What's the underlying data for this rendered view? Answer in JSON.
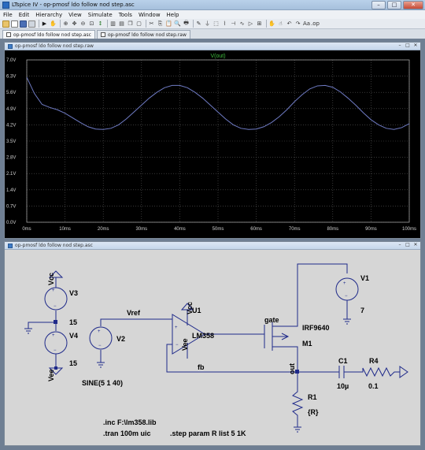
{
  "window": {
    "title": "LTspice IV - op-pmosf ldo follow nod step.asc",
    "minimize_label": "–",
    "maximize_label": "□",
    "close_label": "✕"
  },
  "menu": [
    "File",
    "Edit",
    "Hierarchy",
    "View",
    "Simulate",
    "Tools",
    "Window",
    "Help"
  ],
  "tabs": [
    {
      "label": "op-pmosf ldo follow nod step.asc",
      "active": true
    },
    {
      "label": "op-pmosf ldo follow nod step.raw",
      "active": false
    }
  ],
  "waveform_window": {
    "title": "op-pmosf ldo follow nod step.raw"
  },
  "schematic_window": {
    "title": "op-pmosf ldo follow nod step.asc"
  },
  "chart_data": {
    "type": "line",
    "title": "V(out)",
    "xlabel": "",
    "ylabel": "",
    "x_ticks": [
      "0ms",
      "10ms",
      "20ms",
      "30ms",
      "40ms",
      "50ms",
      "60ms",
      "70ms",
      "80ms",
      "90ms",
      "100ms"
    ],
    "y_ticks": [
      "7.0V",
      "6.3V",
      "5.6V",
      "4.9V",
      "4.2V",
      "3.5V",
      "2.8V",
      "2.1V",
      "1.4V",
      "0.7V",
      "0.0V"
    ],
    "xlim": [
      0,
      100
    ],
    "ylim": [
      0,
      7
    ],
    "grid": true,
    "series": [
      {
        "name": "V(out)",
        "color": "#6f7bc4",
        "x": [
          0,
          2,
          4,
          6,
          8,
          10,
          12,
          14,
          16,
          18,
          20,
          22,
          24,
          26,
          28,
          30,
          32,
          34,
          36,
          38,
          40,
          42,
          44,
          46,
          48,
          50,
          52,
          54,
          56,
          58,
          60,
          62,
          64,
          66,
          68,
          70,
          72,
          74,
          76,
          78,
          80,
          82,
          84,
          86,
          88,
          90,
          92,
          94,
          96,
          98,
          100
        ],
        "values": [
          6.25,
          5.55,
          5.08,
          4.95,
          4.85,
          4.7,
          4.5,
          4.3,
          4.12,
          4.02,
          4.0,
          4.05,
          4.2,
          4.45,
          4.75,
          5.05,
          5.35,
          5.6,
          5.8,
          5.9,
          5.9,
          5.8,
          5.6,
          5.35,
          5.05,
          4.75,
          4.45,
          4.2,
          4.05,
          4.0,
          4.02,
          4.12,
          4.3,
          4.55,
          4.85,
          5.2,
          5.5,
          5.75,
          5.88,
          5.9,
          5.82,
          5.62,
          5.35,
          5.05,
          4.72,
          4.42,
          4.2,
          4.05,
          4.0,
          4.08,
          4.25
        ]
      }
    ]
  },
  "schematic": {
    "labels": {
      "v3": "V3",
      "v3_val": "15",
      "vcc_net": "Vcc",
      "v4": "V4",
      "v4_val": "15",
      "vee_net": "Vee",
      "v2": "V2",
      "v2_val": "SINE(5 1 40)",
      "vref": "Vref",
      "u1": "U1",
      "u1_model": "LM358",
      "u1_vcc": "Vcc",
      "u1_vee": "Vee",
      "gate": "gate",
      "fb": "fb",
      "out": "out",
      "m1": "M1",
      "m1_model": "IRF9640",
      "v1": "V1",
      "v1_val": "7",
      "c1": "C1",
      "c1_val": "10µ",
      "r4": "R4",
      "r4_val": "0.1",
      "r1": "R1",
      "r1_val": "{R}",
      "directive_inc": ".inc F:\\lm358.lib",
      "directive_tran": ".tran 100m uic",
      "directive_step": ".step param R list 5 1K"
    }
  }
}
